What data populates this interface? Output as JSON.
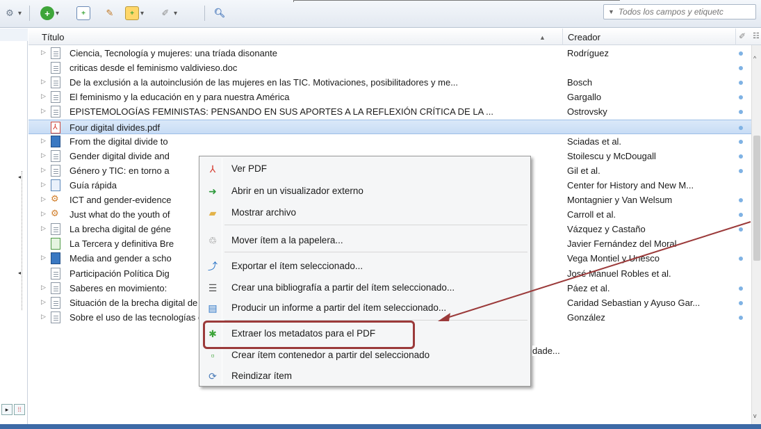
{
  "toolbar": {
    "search_placeholder": "Todos los campos y etiquetc"
  },
  "columns": {
    "title": "Título",
    "creator": "Creador"
  },
  "rows": [
    {
      "title": "Ciencia, Tecnología y mujeres: una tríada disonante",
      "creator": "Rodríguez",
      "icon": "doc",
      "twisty": true,
      "dot": true
    },
    {
      "title": "criticas desde el feminismo valdivieso.doc",
      "creator": "",
      "icon": "doc",
      "twisty": false,
      "dot": true
    },
    {
      "title": "De la exclusión a la autoinclusión de las mujeres en las TIC. Motivaciones, posibilitadores y me...",
      "creator": "Bosch",
      "icon": "doc",
      "twisty": true,
      "dot": true
    },
    {
      "title": "El feminismo y la educación en y para nuestra América",
      "creator": "Gargallo",
      "icon": "doc",
      "twisty": true,
      "dot": true
    },
    {
      "title": "EPISTEMOLOGÍAS FEMINISTAS: PENSANDO EN SUS APORTES A LA REFLEXIÓN CRÍTICA DE LA ...",
      "creator": "Ostrovsky",
      "icon": "doc",
      "twisty": true,
      "dot": true
    },
    {
      "title": "Four digital divides.pdf",
      "creator": "",
      "icon": "pdf",
      "twisty": false,
      "dot": true,
      "selected": true
    },
    {
      "title": "From the digital divide to",
      "creator": "Sciadas et al.",
      "icon": "book",
      "twisty": true,
      "dot": true
    },
    {
      "title": "Gender digital divide and",
      "creator": "Stoilescu y McDougall",
      "icon": "doc",
      "twisty": true,
      "dot": true
    },
    {
      "title": "Género y TIC: en torno a",
      "creator": "Gil et al.",
      "icon": "doc",
      "twisty": true,
      "dot": true
    },
    {
      "title": "Guía rápida",
      "creator": "Center for History and New M...",
      "icon": "web",
      "twisty": true,
      "dot": false
    },
    {
      "title": "ICT and gender-evidence",
      "creator": "Montagnier y Van Welsum",
      "icon": "attach",
      "twisty": true,
      "dot": true
    },
    {
      "title": "Just what do the youth of",
      "creator": "Carroll et al.",
      "icon": "attach",
      "twisty": true,
      "dot": true
    },
    {
      "title": "La brecha digital de géne",
      "creator": "Vázquez y Castaño",
      "icon": "doc",
      "twisty": true,
      "dot": true
    },
    {
      "title": "La Tercera y definitiva Bre",
      "creator": "Javier Fernández del Moral",
      "icon": "table",
      "twisty": false,
      "dot": false
    },
    {
      "title": "Media and gender a scho",
      "creator": "Vega Montiel y Unesco",
      "icon": "book",
      "twisty": true,
      "dot": true
    },
    {
      "title": "Participación Política Dig",
      "creator": "José Manuel Robles et al.",
      "icon": "doc",
      "twisty": false,
      "dot": false
    },
    {
      "title": "Saberes en movimiento:",
      "creator": "Páez et al.",
      "icon": "doc",
      "twisty": true,
      "dot": true
    },
    {
      "title": "Situación de la brecha digital de género y medidas de inclusión en España",
      "creator": "Caridad Sebastian y Ayuso Gar...",
      "icon": "doc",
      "twisty": true,
      "dot": true
    },
    {
      "title": "Sobre el uso de las tecnologías en la sociedad tres perspectivas teóricas para el estudio de las te...",
      "creator": "González",
      "icon": "doc",
      "twisty": true,
      "dot": true
    }
  ],
  "context_menu": {
    "view_pdf": "Ver PDF",
    "open_external": "Abrir en un visualizador externo",
    "show_file": "Mostrar archivo",
    "move_trash": "Mover ítem a la papelera...",
    "export_item": "Exportar el ítem seleccionado...",
    "create_bibliography": "Crear una bibliografía a partir del ítem seleccionado...",
    "generate_report": "Producir un informe a partir del ítem seleccionado...",
    "retrieve_metadata": "Extraer los metadatos para el PDF",
    "create_parent": "Crear ítem contenedor a partir del seleccionado",
    "reindex": "Reindizar ítem",
    "partial_hidden_text": "dade..."
  },
  "colors": {
    "annotation": "#9b3a3a",
    "selection": "#c8dcf5",
    "sync_dot": "#7fb2e4"
  }
}
